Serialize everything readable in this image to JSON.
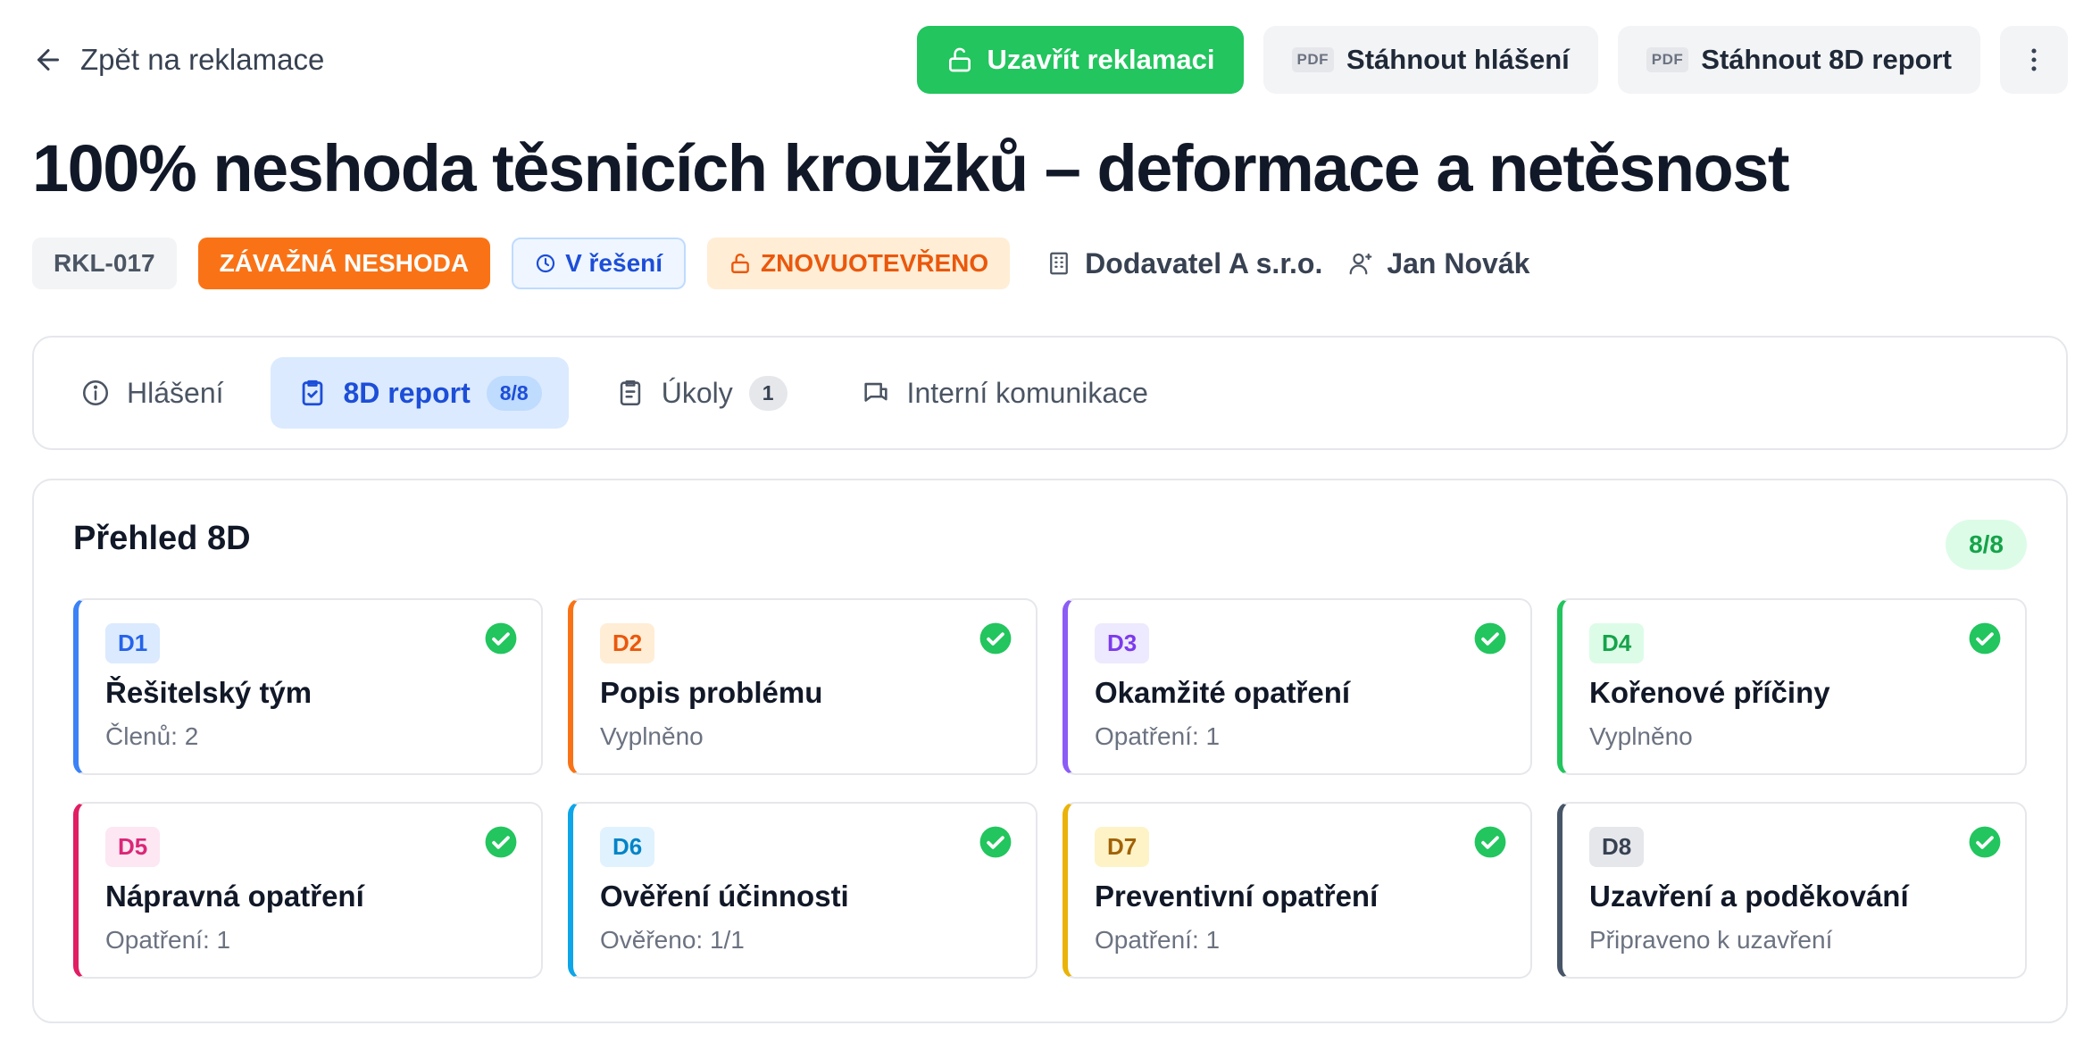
{
  "nav": {
    "back_label": "Zpět na reklamace",
    "close_label": "Uzavřít reklamaci",
    "download_report_label": "Stáhnout hlášení",
    "download_8d_label": "Stáhnout 8D report",
    "pdf_tag": "PDF",
    "more_icon": "more-vertical-icon"
  },
  "title": "100% neshoda těsnicích kroužků – deformace a netěsnost",
  "meta": {
    "id": "RKL-017",
    "severity": "ZÁVAŽNÁ NESHODA",
    "state": "V řešení",
    "reopened": "ZNOVUOTEVŘENO",
    "supplier": "Dodavatel A s.r.o.",
    "owner": "Jan Novák"
  },
  "tabs": [
    {
      "label": "Hlášení",
      "icon": "info-icon"
    },
    {
      "label": "8D report",
      "count": "8/8",
      "icon": "clipboard-check-icon",
      "active": true
    },
    {
      "label": "Úkoly",
      "count": "1",
      "icon": "clipboard-list-icon"
    },
    {
      "label": "Interní komunikace",
      "icon": "message-icon"
    }
  ],
  "overview": {
    "title": "Přehled 8D",
    "badge": "8/8",
    "cards": [
      {
        "code": "D1",
        "title": "Řešitelský tým",
        "sub": "Členů: 2",
        "color": "#3b82f6",
        "tag_bg": "#dbeafe",
        "tag_fg": "#2563eb"
      },
      {
        "code": "D2",
        "title": "Popis problému",
        "sub": "Vyplněno",
        "color": "#f97316",
        "tag_bg": "#ffedd5",
        "tag_fg": "#ea580c"
      },
      {
        "code": "D3",
        "title": "Okamžité opatření",
        "sub": "Opatření: 1",
        "color": "#8b5cf6",
        "tag_bg": "#ede9fe",
        "tag_fg": "#7c3aed"
      },
      {
        "code": "D4",
        "title": "Kořenové příčiny",
        "sub": "Vyplněno",
        "color": "#22c55e",
        "tag_bg": "#dcfce7",
        "tag_fg": "#16a34a"
      },
      {
        "code": "D5",
        "title": "Nápravná opatření",
        "sub": "Opatření: 1",
        "color": "#e11d63",
        "tag_bg": "#fce7f3",
        "tag_fg": "#db2777"
      },
      {
        "code": "D6",
        "title": "Ověření účinnosti",
        "sub": "Ověřeno: 1/1",
        "color": "#0ea5e9",
        "tag_bg": "#e0f2fe",
        "tag_fg": "#0284c7"
      },
      {
        "code": "D7",
        "title": "Preventivní opatření",
        "sub": "Opatření: 1",
        "color": "#eab308",
        "tag_bg": "#fef3c7",
        "tag_fg": "#a16207"
      },
      {
        "code": "D8",
        "title": "Uzavření a poděkování",
        "sub": "Připraveno k uzavření",
        "color": "#475569",
        "tag_bg": "#e5e7eb",
        "tag_fg": "#374151"
      }
    ]
  }
}
